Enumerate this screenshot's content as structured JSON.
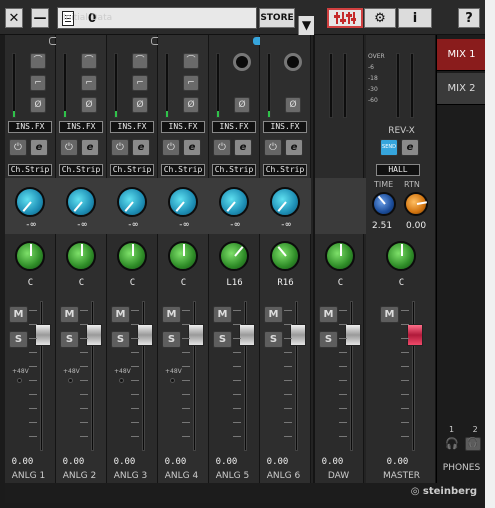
{
  "topbar": {
    "close": "✕",
    "minimize": "—",
    "scene_number": "0",
    "scene_name": "Initial Data",
    "dropdown": "▼",
    "store": "STORE",
    "settings": "⚙",
    "info": "i",
    "help": "?"
  },
  "channels": [
    {
      "label": "ANLG 1",
      "fx": "INS.FX",
      "strip": "Ch.Strip",
      "send": "-∞",
      "pan": "C",
      "level": "0.00",
      "phantom": "+48V"
    },
    {
      "label": "ANLG 2",
      "fx": "INS.FX",
      "strip": "Ch.Strip",
      "send": "-∞",
      "pan": "C",
      "level": "0.00",
      "phantom": "+48V"
    },
    {
      "label": "ANLG 3",
      "fx": "INS.FX",
      "strip": "Ch.Strip",
      "send": "-∞",
      "pan": "C",
      "level": "0.00",
      "phantom": "+48V"
    },
    {
      "label": "ANLG 4",
      "fx": "INS.FX",
      "strip": "Ch.Strip",
      "send": "-∞",
      "pan": "C",
      "level": "0.00",
      "phantom": "+48V"
    },
    {
      "label": "ANLG 5",
      "fx": "INS.FX",
      "strip": "Ch.Strip",
      "send": "-∞",
      "pan": "L16",
      "level": "0.00",
      "phantom": ""
    },
    {
      "label": "ANLG 6",
      "fx": "INS.FX",
      "strip": "Ch.Strip",
      "send": "-∞",
      "pan": "R16",
      "level": "0.00",
      "phantom": ""
    }
  ],
  "daw": {
    "label": "DAW",
    "pan": "C",
    "level": "0.00"
  },
  "master": {
    "label": "MASTER",
    "level": "0.00",
    "pan": "C",
    "reverb_title": "REV-X",
    "send_badge": "SEND",
    "reverb_type": "HALL",
    "time_label": "TIME",
    "rtn_label": "RTN",
    "time_value": "2.51",
    "rtn_value": "0.00",
    "meter_scale": [
      "OVER",
      "-6",
      "-18",
      "-30",
      "-60"
    ]
  },
  "mix_tabs": [
    "MIX 1",
    "MIX 2"
  ],
  "phones": {
    "label": "PHONES",
    "num1": "1",
    "num2": "2"
  },
  "brand": "steinberg",
  "buttons": {
    "mute": "M",
    "solo": "S",
    "edit": "e"
  }
}
